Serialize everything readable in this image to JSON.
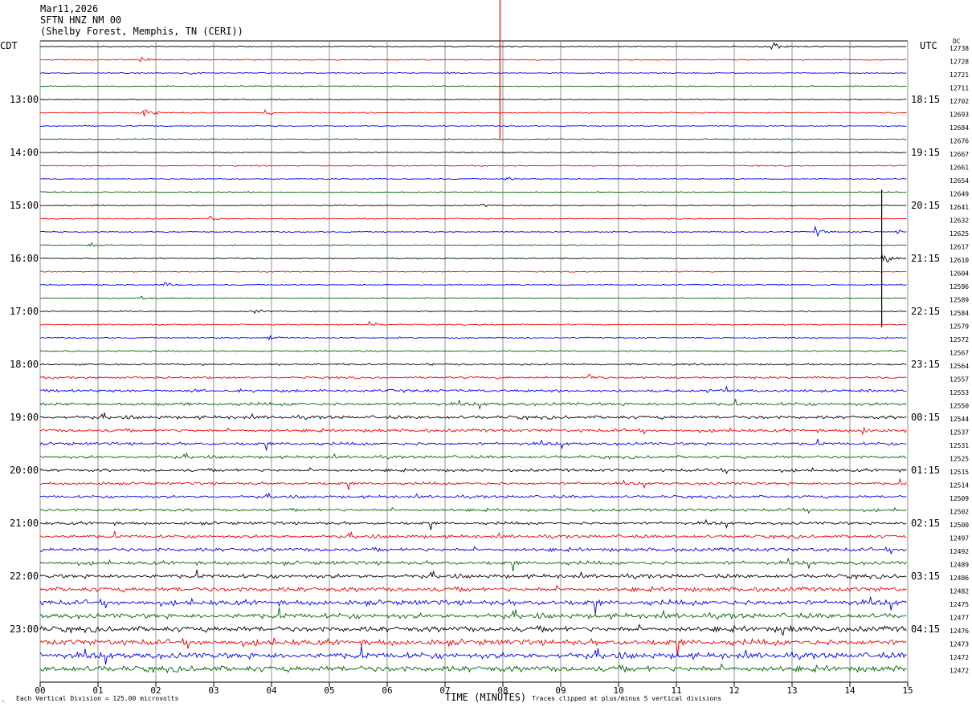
{
  "header": {
    "date": "Mar11,2026",
    "station": "SFTN HNZ NM 00",
    "location": "(Shelby Forest, Memphis, TN (CERI))"
  },
  "left_axis_title": "CDT",
  "right_axis_title": "UTC",
  "dc_label": "DC",
  "footer": {
    "scale_note": "Each Vertical Division =  125.00 microvolts",
    "xlabel": "TIME (MINUTES)",
    "clip_note": "Traces clipped at plus/minus 5 vertical divisions",
    "corner_mark": "⸌"
  },
  "colors": {
    "cycle": [
      "#000000",
      "#ee0000",
      "#0000ee",
      "#006400"
    ],
    "grid": "#777777"
  },
  "chart_data": {
    "type": "line",
    "title": "Mar11,2026",
    "xlabel": "TIME (MINUTES)",
    "xlim": [
      0,
      15
    ],
    "x_ticks": [
      "00",
      "01",
      "02",
      "03",
      "04",
      "05",
      "06",
      "07",
      "08",
      "09",
      "10",
      "11",
      "12",
      "13",
      "14",
      "15"
    ],
    "rows": 48,
    "minutes_per_row": 15,
    "left_hour_labels": [
      {
        "row": 4,
        "label": "13:00"
      },
      {
        "row": 8,
        "label": "14:00"
      },
      {
        "row": 12,
        "label": "15:00"
      },
      {
        "row": 16,
        "label": "16:00"
      },
      {
        "row": 20,
        "label": "17:00"
      },
      {
        "row": 24,
        "label": "18:00"
      },
      {
        "row": 28,
        "label": "19:00"
      },
      {
        "row": 32,
        "label": "20:00"
      },
      {
        "row": 36,
        "label": "21:00"
      },
      {
        "row": 40,
        "label": "22:00"
      },
      {
        "row": 44,
        "label": "23:00"
      }
    ],
    "right_hour_labels": [
      {
        "row": 4,
        "label": "18:15"
      },
      {
        "row": 8,
        "label": "19:15"
      },
      {
        "row": 12,
        "label": "20:15"
      },
      {
        "row": 16,
        "label": "21:15"
      },
      {
        "row": 20,
        "label": "22:15"
      },
      {
        "row": 24,
        "label": "23:15"
      },
      {
        "row": 28,
        "label": "00:15"
      },
      {
        "row": 32,
        "label": "01:15"
      },
      {
        "row": 36,
        "label": "02:15"
      },
      {
        "row": 40,
        "label": "03:15"
      },
      {
        "row": 44,
        "label": "04:15"
      }
    ],
    "dc_offsets": [
      12738,
      12728,
      12721,
      12711,
      12702,
      12693,
      12684,
      12676,
      12667,
      12661,
      12654,
      12649,
      12641,
      12632,
      12625,
      12617,
      12610,
      12604,
      12596,
      12589,
      12584,
      12579,
      12572,
      12567,
      12564,
      12557,
      12553,
      12550,
      12544,
      12537,
      12531,
      12525,
      12515,
      12514,
      12509,
      12502,
      12500,
      12497,
      12492,
      12489,
      12486,
      12482,
      12475,
      12477,
      12476,
      12473,
      12472,
      12472
    ],
    "noise_level": [
      0.6,
      0.6,
      0.6,
      0.6,
      0.6,
      0.6,
      0.6,
      0.6,
      0.6,
      0.6,
      0.6,
      0.6,
      0.6,
      0.6,
      0.6,
      0.6,
      0.6,
      0.6,
      0.6,
      0.6,
      0.6,
      0.7,
      0.7,
      0.8,
      1.0,
      1.2,
      1.5,
      1.7,
      1.8,
      1.7,
      1.6,
      1.6,
      1.6,
      1.5,
      1.5,
      1.5,
      1.6,
      1.8,
      2.0,
      2.0,
      2.2,
      2.5,
      2.8,
      2.8,
      3.0,
      3.2,
      3.2,
      3.2
    ],
    "events": [
      {
        "row": 0,
        "minute": 12.65,
        "amp": 3.5
      },
      {
        "row": 1,
        "minute": 1.75,
        "amp": 1.8
      },
      {
        "row": 2,
        "minute": 2.6,
        "amp": 1.2
      },
      {
        "row": 2,
        "minute": 7.05,
        "amp": 1.2
      },
      {
        "row": 5,
        "minute": 1.8,
        "amp": 8.0
      },
      {
        "row": 5,
        "minute": 3.9,
        "amp": 2.5
      },
      {
        "row": 8,
        "minute": 7.8,
        "amp": 1.0
      },
      {
        "row": 10,
        "minute": 8.05,
        "amp": 1.8
      },
      {
        "row": 11,
        "minute": 2.6,
        "amp": 1.2
      },
      {
        "row": 12,
        "minute": 7.65,
        "amp": 1.0
      },
      {
        "row": 13,
        "minute": 2.95,
        "amp": 2.5
      },
      {
        "row": 14,
        "minute": 13.4,
        "amp": 3.5
      },
      {
        "row": 14,
        "minute": 14.8,
        "amp": 2.2
      },
      {
        "row": 15,
        "minute": 0.85,
        "amp": 1.8
      },
      {
        "row": 16,
        "minute": 14.55,
        "amp": 5.0
      },
      {
        "row": 18,
        "minute": 2.15,
        "amp": 2.0
      },
      {
        "row": 19,
        "minute": 1.75,
        "amp": 2.0
      },
      {
        "row": 20,
        "minute": 3.7,
        "amp": 2.0
      },
      {
        "row": 21,
        "minute": 5.7,
        "amp": 2.0
      },
      {
        "row": 22,
        "minute": 3.95,
        "amp": 3.0
      },
      {
        "row": 25,
        "minute": 9.5,
        "amp": 2.2
      },
      {
        "row": 29,
        "minute": 14.25,
        "amp": 2.2
      },
      {
        "row": 44,
        "minute": 12.85,
        "amp": 2.5
      }
    ],
    "vertical_spikes": [
      {
        "row": 0,
        "minute": 7.95,
        "from": -6.5,
        "to": 7.0,
        "color": "#ee0000"
      },
      {
        "row": 12,
        "minute": 14.55,
        "from": -1.2,
        "to": 9.2,
        "color": "#000000"
      }
    ]
  }
}
